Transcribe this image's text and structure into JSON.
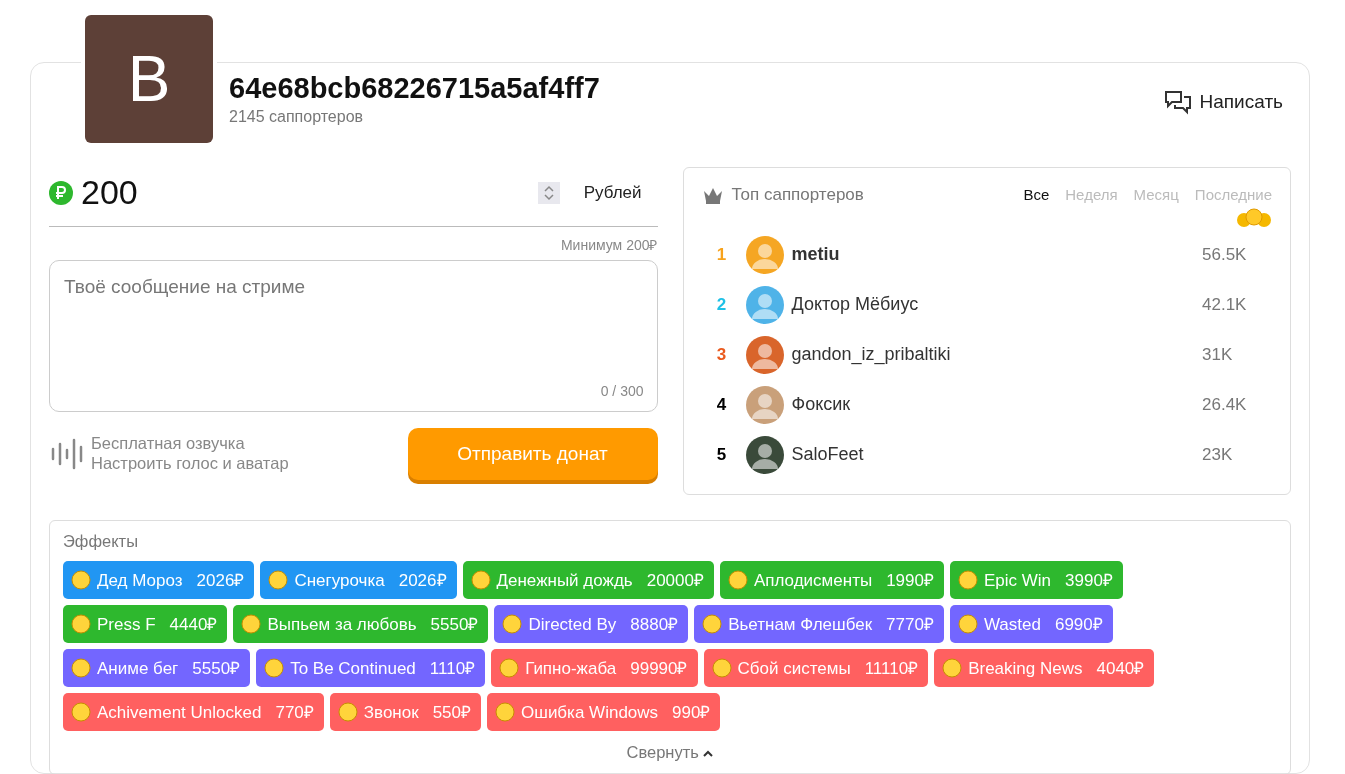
{
  "profile": {
    "avatar_letter": "B",
    "name": "64e68bcb68226715a5af4ff7",
    "supporters": "2145 саппортеров",
    "write_button": "Написать"
  },
  "donation": {
    "amount": "200",
    "currency": "Рублей",
    "minimum": "Минимум 200₽",
    "message_placeholder": "Твоё сообщение на стриме",
    "counter": "0 / 300",
    "voice_title": "Бесплатная озвучка",
    "voice_link": "Настроить голос и аватар",
    "submit": "Отправить донат"
  },
  "top": {
    "title": "Топ саппортеров",
    "tabs": [
      {
        "label": "Все",
        "selected": true
      },
      {
        "label": "Неделя",
        "selected": false
      },
      {
        "label": "Месяц",
        "selected": false
      },
      {
        "label": "Последние",
        "selected": false
      }
    ],
    "rows": [
      {
        "rank": "1",
        "color": "#f7a21b",
        "name": "metiu",
        "highlighted": true,
        "amount": "56.5K"
      },
      {
        "rank": "2",
        "color": "#1fc1e6",
        "name": "Доктор Мёбиус",
        "highlighted": false,
        "amount": "42.1K"
      },
      {
        "rank": "3",
        "color": "#ea5a1e",
        "name": "gandon_iz_pribaltiki",
        "highlighted": false,
        "amount": "31K"
      },
      {
        "rank": "4",
        "color": "#000000",
        "name": "Фоксик",
        "highlighted": false,
        "amount": "26.4K"
      },
      {
        "rank": "5",
        "color": "#000000",
        "name": "SaloFeet",
        "highlighted": false,
        "amount": "23K"
      }
    ]
  },
  "effects": {
    "title": "Эффекты",
    "collapse": "Свернуть",
    "items": [
      {
        "name": "Дед Мороз",
        "price": "2026₽",
        "color": "#2196f3"
      },
      {
        "name": "Снегурочка",
        "price": "2026₽",
        "color": "#2196f3"
      },
      {
        "name": "Денежный дождь",
        "price": "20000₽",
        "color": "#2eb82e"
      },
      {
        "name": "Аплодисменты",
        "price": "1990₽",
        "color": "#2eb82e"
      },
      {
        "name": "Epic Win",
        "price": "3990₽",
        "color": "#2eb82e"
      },
      {
        "name": "Press F",
        "price": "4440₽",
        "color": "#2eb82e"
      },
      {
        "name": "Выпьем за любовь",
        "price": "5550₽",
        "color": "#2eb82e"
      },
      {
        "name": "Directed By",
        "price": "8880₽",
        "color": "#7366ff"
      },
      {
        "name": "Вьетнам Флешбек",
        "price": "7770₽",
        "color": "#7366ff"
      },
      {
        "name": "Wasted",
        "price": "6990₽",
        "color": "#7366ff"
      },
      {
        "name": "Аниме бег",
        "price": "5550₽",
        "color": "#7366ff"
      },
      {
        "name": "To Be Continued",
        "price": "1110₽",
        "color": "#7366ff"
      },
      {
        "name": "Гипно-жаба",
        "price": "99990₽",
        "color": "#ff6060"
      },
      {
        "name": "Сбой системы",
        "price": "11110₽",
        "color": "#ff6060"
      },
      {
        "name": "Breaking News",
        "price": "4040₽",
        "color": "#ff6060"
      },
      {
        "name": "Achivement Unlocked",
        "price": "770₽",
        "color": "#ff6060"
      },
      {
        "name": "Звонок",
        "price": "550₽",
        "color": "#ff6060"
      },
      {
        "name": "Ошибка Windows",
        "price": "990₽",
        "color": "#ff6060"
      }
    ]
  }
}
